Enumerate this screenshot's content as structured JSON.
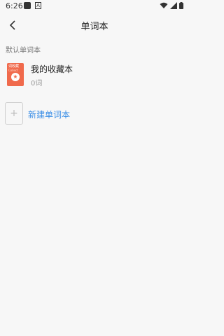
{
  "status_bar": {
    "time": "6:26",
    "icon_b_text": "A",
    "icons": [
      "wifi-icon",
      "signal-icon",
      "battery-icon"
    ]
  },
  "app_bar": {
    "title": "单词本",
    "back_icon": "chevron-left-icon"
  },
  "section": {
    "label": "默认单词本"
  },
  "books": [
    {
      "name": "我的收藏本",
      "count": "0词",
      "cover": {
        "line1": "词收藏",
        "line2": "Collect",
        "color": "#f06a4c",
        "icon": "star-icon"
      }
    }
  ],
  "new_book": {
    "label": "新建单词本",
    "icon": "plus-icon",
    "accent": "#3a8ee6"
  }
}
